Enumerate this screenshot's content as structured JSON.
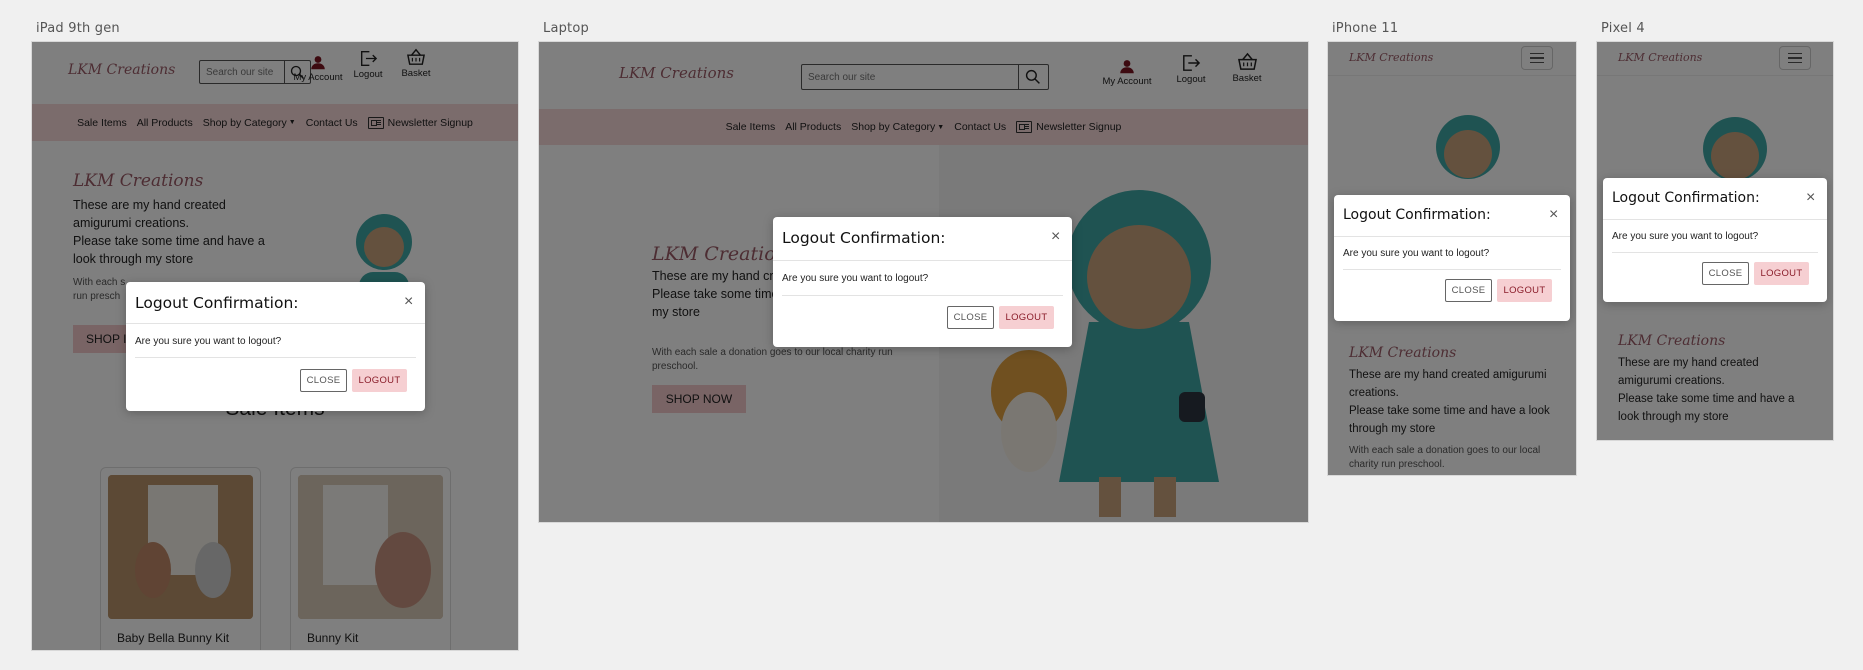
{
  "devices": [
    {
      "label": "iPad 9th gen"
    },
    {
      "label": "Laptop"
    },
    {
      "label": "iPhone 11"
    },
    {
      "label": "Pixel 4"
    }
  ],
  "brand": {
    "logo_text": "LKM Creations",
    "accent": "#f6d8d9",
    "logo_color": "#9b5b67",
    "button_color": "#f3c9cb"
  },
  "search": {
    "placeholder": "Search our site",
    "icon": "search-icon"
  },
  "header_icons": {
    "account": {
      "label": "My Account",
      "icon": "user-icon"
    },
    "logout": {
      "label": "Logout",
      "icon": "logout-icon"
    },
    "basket": {
      "label": "Basket",
      "icon": "basket-icon"
    }
  },
  "nav": {
    "sale_items": "Sale Items",
    "all_products": "All Products",
    "shop_by_category": "Shop by Category",
    "contact_us": "Contact Us",
    "newsletter_signup": "Newsletter Signup"
  },
  "hero": {
    "title": "LKM Creations",
    "line1": "These are my hand created amigurumi creations.",
    "line2": "Please take some time and have a look through my store",
    "donation": "With each sale a donation goes to our local charity run preschool.",
    "shop_now": "SHOP NOW",
    "ipad_shop_partial": "SHOP I",
    "ipad_donation_partial": "With each s",
    "ipad_donation_partial2": "run presch",
    "laptop_line1_partial": "These are my hand crea",
    "laptop_line2_partial": "Please take some time a",
    "laptop_line3": "my store",
    "laptop_title_partial": "LKM Creations"
  },
  "sale_section": {
    "title": "Sale Items"
  },
  "products": [
    {
      "name": "Baby Bella Bunny Kit"
    },
    {
      "name": "Bunny Kit"
    }
  ],
  "modal": {
    "title": "Logout Confirmation:",
    "message": "Are you sure you want to logout?",
    "close_label": "CLOSE",
    "logout_label": "LOGOUT",
    "close_x": "×"
  }
}
